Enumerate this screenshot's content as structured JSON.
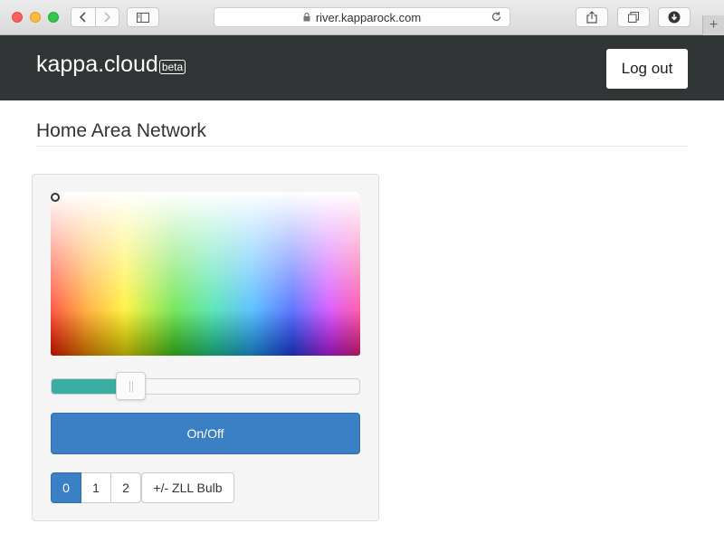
{
  "browser": {
    "url": "river.kapparock.com",
    "icons": {
      "back": "chevron-left-icon",
      "forward": "chevron-right-icon",
      "sidebar": "sidebar-icon",
      "lock": "lock-icon",
      "reload": "reload-icon",
      "share": "share-icon",
      "tabs": "tabs-icon",
      "downloads": "download-icon",
      "new_tab": "plus-icon"
    }
  },
  "navbar": {
    "brand": "kappa.cloud",
    "badge": "beta",
    "logout_label": "Log out",
    "background": "#313536"
  },
  "page": {
    "title": "Home Area Network"
  },
  "controls": {
    "brightness_fraction": 0.26,
    "onoff_label": "On/Off",
    "accent_color": "#3b7fc4",
    "slider_color": "#3aaea2",
    "device_buttons": [
      {
        "label": "0",
        "active": true
      },
      {
        "label": "1",
        "active": false
      },
      {
        "label": "2",
        "active": false
      }
    ],
    "zll_label": "+/- ZLL Bulb"
  }
}
